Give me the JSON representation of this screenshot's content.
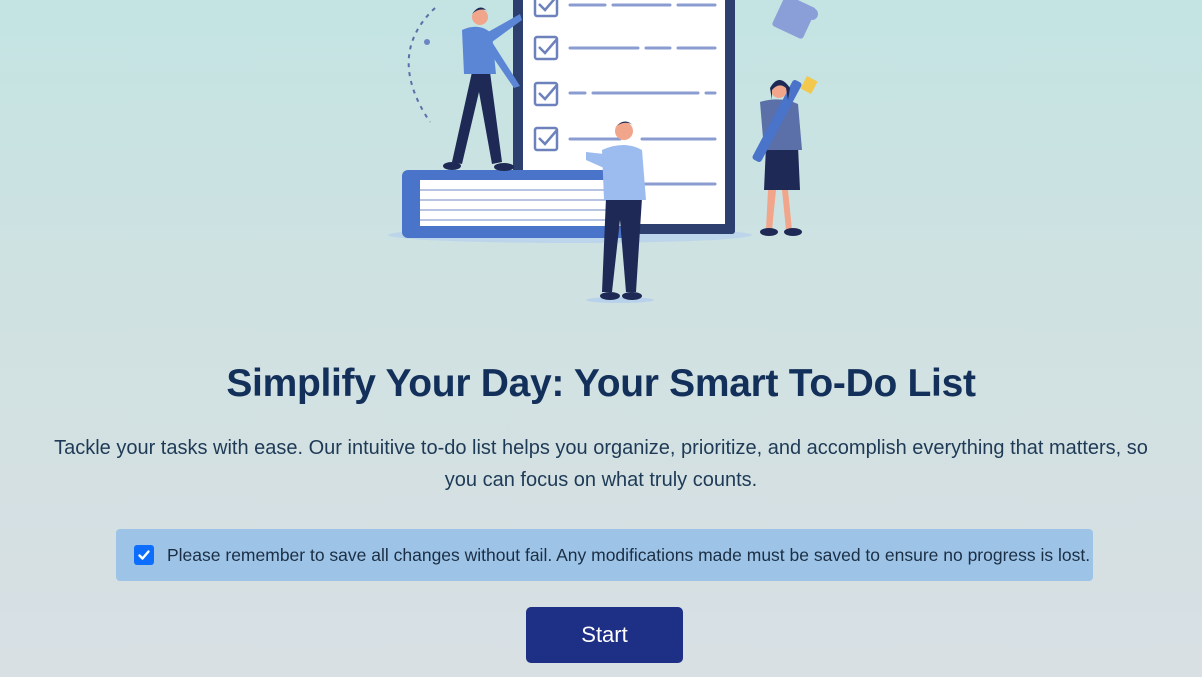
{
  "hero": {
    "illustration": "checklist-illustration"
  },
  "heading": {
    "title": "Simplify Your Day: Your Smart To-Do List",
    "subtitle_line1": "Tackle your tasks with ease. Our intuitive to-do list helps you organize, prioritize, and accomplish everything that matters, so",
    "subtitle_line2": "you can focus on what truly counts."
  },
  "notice": {
    "checked": true,
    "text": "Please remember to save all changes without fail. Any modifications made must be saved to ensure no progress is lost."
  },
  "actions": {
    "start_label": "Start"
  },
  "colors": {
    "title": "#13305a",
    "notice_bg": "#9dc4e7",
    "checkbox": "#0d6efd",
    "button": "#1e2f86"
  }
}
